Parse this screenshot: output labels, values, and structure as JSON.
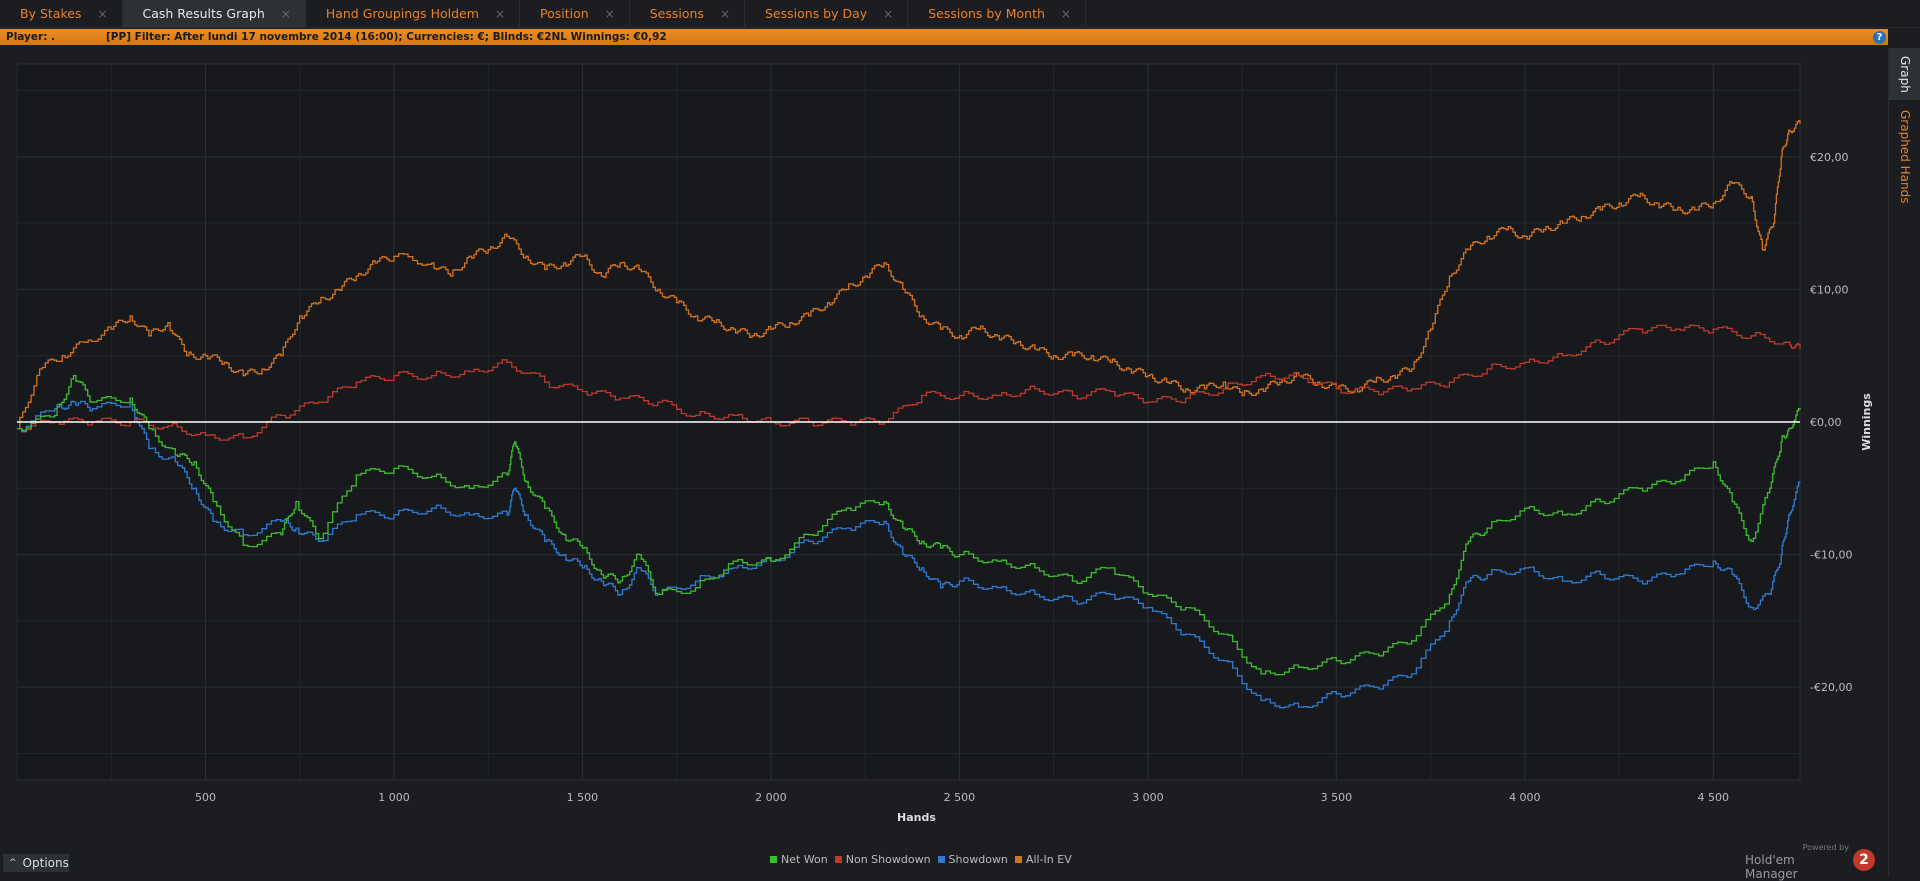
{
  "tabs": [
    {
      "label": "By Stakes",
      "active": false
    },
    {
      "label": "Cash Results Graph",
      "active": true
    },
    {
      "label": "Hand Groupings Holdem",
      "active": false
    },
    {
      "label": "Position",
      "active": false
    },
    {
      "label": "Sessions",
      "active": false
    },
    {
      "label": "Sessions by Day",
      "active": false
    },
    {
      "label": "Sessions by Month",
      "active": false
    }
  ],
  "tab_close": "×",
  "filterbar": {
    "player_label": "Player: .",
    "filter_text": "[PP]  Filter:  After lundi 17 novembre 2014 (16:00); Currencies: €; Blinds: €2NL  Winnings:  €0,92",
    "help": "?"
  },
  "side_tabs": {
    "graph": "Graph",
    "graphed_hands": "Graphed Hands"
  },
  "options": {
    "caret": "^",
    "label": "Options"
  },
  "logo": {
    "powered_by": "Powered by",
    "name": "Hold'em Manager",
    "badge": "2"
  },
  "colors": {
    "background": "#1b1d20",
    "accent": "#e8822a",
    "net_won": "#3dbd2e",
    "non_showdown": "#c0392b",
    "showdown": "#2f7bd1",
    "all_in_ev": "#d4731f",
    "zero_line": "#ffffff"
  },
  "chart_data": {
    "type": "line",
    "xlabel": "Hands",
    "ylabel": "Winnings",
    "xlim": [
      0,
      4730
    ],
    "ylim": [
      -27,
      27
    ],
    "xticks": [
      500,
      1000,
      1500,
      2000,
      2500,
      3000,
      3500,
      4000,
      4500
    ],
    "xtick_labels": [
      "500",
      "1 000",
      "1 500",
      "2 000",
      "2 500",
      "3 000",
      "3 500",
      "4 000",
      "4 500"
    ],
    "yticks": [
      20,
      10,
      0,
      -10,
      -20
    ],
    "ytick_labels": [
      "€20,00",
      "€10,00",
      "€0,00",
      "-€10,00",
      "-€20,00"
    ],
    "grid": true,
    "legend_position": "bottom-center",
    "series": [
      {
        "name": "Net Won",
        "color": "#3dbd2e",
        "x": [
          0,
          100,
          150,
          200,
          300,
          350,
          420,
          470,
          520,
          600,
          700,
          740,
          800,
          900,
          1000,
          1100,
          1200,
          1300,
          1320,
          1350,
          1400,
          1450,
          1500,
          1550,
          1600,
          1650,
          1700,
          1800,
          1900,
          2000,
          2100,
          2200,
          2300,
          2350,
          2400,
          2450,
          2500,
          2600,
          2700,
          2800,
          2900,
          3000,
          3100,
          3200,
          3300,
          3400,
          3500,
          3600,
          3700,
          3800,
          3850,
          3900,
          4000,
          4100,
          4200,
          4300,
          4400,
          4500,
          4550,
          4600,
          4650,
          4680,
          4700,
          4730
        ],
        "y": [
          -0.5,
          0.5,
          3.5,
          1.5,
          1.8,
          -0.5,
          -2.5,
          -3,
          -6,
          -9.3,
          -8.5,
          -6,
          -8.8,
          -4,
          -3.5,
          -4.1,
          -5,
          -4,
          -1.5,
          -4.5,
          -6.5,
          -8.5,
          -9.5,
          -11.5,
          -12,
          -10,
          -13,
          -12.5,
          -10.5,
          -10.5,
          -8.5,
          -6.5,
          -6,
          -8,
          -9,
          -9.5,
          -10,
          -10.5,
          -11,
          -12,
          -11,
          -13,
          -14,
          -16,
          -19,
          -18.5,
          -18,
          -17.5,
          -16.5,
          -13,
          -9,
          -8,
          -6.5,
          -7,
          -6,
          -5,
          -4.5,
          -3,
          -6,
          -9,
          -5,
          -1.5,
          -0.5,
          0.92
        ]
      },
      {
        "name": "Non Showdown",
        "color": "#c0392b",
        "x": [
          0,
          100,
          200,
          300,
          400,
          500,
          600,
          700,
          800,
          900,
          1000,
          1100,
          1200,
          1300,
          1400,
          1500,
          1600,
          1700,
          1800,
          1900,
          2000,
          2100,
          2200,
          2300,
          2400,
          2500,
          2600,
          2700,
          2800,
          2900,
          3000,
          3100,
          3200,
          3300,
          3400,
          3500,
          3600,
          3700,
          3800,
          3900,
          4000,
          4100,
          4200,
          4300,
          4400,
          4500,
          4600,
          4700,
          4730
        ],
        "y": [
          -0.5,
          0,
          0,
          0,
          -0.3,
          -1,
          -1.2,
          0.5,
          1.5,
          3,
          3.5,
          3.5,
          3.8,
          4.5,
          3,
          2.3,
          1.8,
          1.5,
          0.5,
          0.5,
          0,
          0,
          0,
          0,
          2,
          2,
          2,
          2.5,
          2,
          2.3,
          1.5,
          1.8,
          2.5,
          3.5,
          3.5,
          2.5,
          2.3,
          2.5,
          3,
          4,
          4.5,
          5,
          6,
          7,
          7,
          7,
          6.5,
          6,
          5.5
        ]
      },
      {
        "name": "Showdown",
        "color": "#2f7bd1",
        "x": [
          0,
          100,
          150,
          200,
          300,
          350,
          420,
          470,
          520,
          600,
          700,
          740,
          800,
          900,
          1000,
          1100,
          1200,
          1300,
          1320,
          1350,
          1400,
          1450,
          1500,
          1550,
          1600,
          1650,
          1700,
          1800,
          1900,
          2000,
          2100,
          2200,
          2300,
          2350,
          2400,
          2450,
          2500,
          2600,
          2700,
          2800,
          2900,
          3000,
          3100,
          3200,
          3300,
          3400,
          3500,
          3600,
          3700,
          3800,
          3850,
          3900,
          4000,
          4100,
          4200,
          4300,
          4400,
          4500,
          4550,
          4600,
          4650,
          4680,
          4700,
          4730
        ],
        "y": [
          -0.5,
          1,
          1.5,
          1,
          1.5,
          -2,
          -3,
          -5,
          -7.5,
          -8.5,
          -7.5,
          -8,
          -9,
          -7,
          -7,
          -6.5,
          -7,
          -7,
          -5,
          -7,
          -9,
          -10,
          -11,
          -12,
          -13,
          -11,
          -13,
          -12,
          -11,
          -10.5,
          -9,
          -8,
          -7.5,
          -10,
          -11,
          -12.5,
          -12,
          -12.5,
          -13,
          -13.5,
          -13,
          -14,
          -16,
          -18,
          -21,
          -21.5,
          -20.5,
          -20,
          -19,
          -15,
          -12,
          -11.5,
          -11,
          -12,
          -11.5,
          -12,
          -11.5,
          -10.5,
          -11.5,
          -14,
          -13,
          -10,
          -7,
          -4.5
        ]
      },
      {
        "name": "All-In EV",
        "color": "#d4731f",
        "x": [
          0,
          60,
          120,
          180,
          250,
          300,
          350,
          400,
          450,
          500,
          550,
          600,
          650,
          700,
          750,
          800,
          850,
          900,
          950,
          1000,
          1100,
          1150,
          1200,
          1250,
          1300,
          1350,
          1400,
          1450,
          1500,
          1550,
          1600,
          1650,
          1700,
          1750,
          1800,
          1850,
          1900,
          1950,
          2000,
          2050,
          2100,
          2150,
          2200,
          2250,
          2300,
          2350,
          2400,
          2450,
          2500,
          2550,
          2600,
          2650,
          2700,
          2750,
          2800,
          2850,
          2900,
          2950,
          3000,
          3050,
          3100,
          3150,
          3200,
          3250,
          3300,
          3350,
          3400,
          3450,
          3500,
          3550,
          3600,
          3650,
          3700,
          3750,
          3800,
          3850,
          3900,
          3950,
          4000,
          4050,
          4100,
          4150,
          4200,
          4250,
          4300,
          4350,
          4400,
          4450,
          4500,
          4550,
          4600,
          4630,
          4660,
          4680,
          4700,
          4730
        ],
        "y": [
          -0.5,
          4,
          5,
          6,
          7,
          8,
          6.5,
          7.5,
          5,
          5,
          4.5,
          3.5,
          4,
          5,
          8,
          9,
          10,
          11,
          12,
          12.5,
          12,
          11,
          12.5,
          13,
          14,
          12.5,
          11.5,
          12,
          12.5,
          11,
          12,
          11.5,
          10,
          9,
          8,
          7.5,
          7,
          6.5,
          7,
          7.5,
          8,
          9,
          10,
          11,
          12,
          10,
          8,
          7,
          6.5,
          7,
          6.5,
          6,
          5.5,
          5,
          5,
          5,
          4.5,
          4,
          3.5,
          3,
          2.5,
          2.5,
          3,
          2,
          2.5,
          3,
          3.5,
          3,
          2.5,
          2.5,
          3,
          3.5,
          4,
          7,
          11,
          13,
          14,
          14.5,
          14,
          14.5,
          15,
          15.5,
          16,
          16.5,
          17,
          16.5,
          16,
          16,
          16.5,
          18,
          17,
          13,
          15,
          20,
          22,
          22.5
        ]
      }
    ]
  }
}
